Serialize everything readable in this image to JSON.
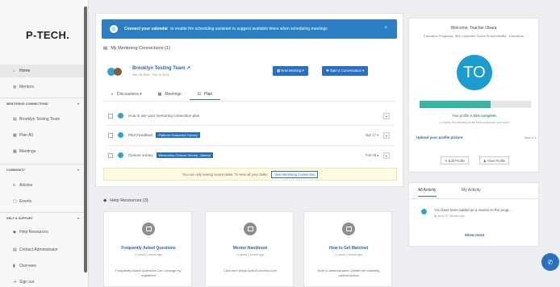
{
  "brand": {
    "logo": "P-TECH."
  },
  "sidebar": {
    "top_items": [
      {
        "label": "Home",
        "icon": "home-icon",
        "glyph": "⌂"
      },
      {
        "label": "Mentors",
        "icon": "person-icon",
        "glyph": "◍"
      }
    ],
    "sections": [
      {
        "title": "MENTORING CONNECTIONS",
        "items": [
          {
            "label": "Brooklyn Testing Team",
            "glyph": "▤"
          },
          {
            "label": "Plan All",
            "glyph": "▦"
          },
          {
            "label": "Meetings",
            "glyph": "▦"
          }
        ]
      },
      {
        "title": "COMMUNITY",
        "items": [
          {
            "label": "Articles",
            "glyph": "≡"
          },
          {
            "label": "Events",
            "glyph": "▢"
          }
        ]
      },
      {
        "title": "HELP & SUPPORT",
        "items": [
          {
            "label": "Help Resources",
            "glyph": "◆"
          },
          {
            "label": "Contact Administrator",
            "glyph": "▤"
          },
          {
            "label": "Overview",
            "glyph": "▮"
          },
          {
            "label": "Sign out",
            "glyph": "⇥"
          }
        ]
      }
    ]
  },
  "banner": {
    "bold": "Connect your calendar",
    "text": "to enable the scheduling assistant to suggest available times when scheduling meetings",
    "close": "×"
  },
  "mentoring": {
    "section_title": "My Mentoring Connections (1)",
    "team_name": "Brooklyn Testing Team ↗",
    "dates": "Feb 05 2020 - Feb 11 2021",
    "new_meeting": "▦ New Meeting ▾",
    "start_conversation": "✚ Start a Conversation ▾",
    "tabs": [
      {
        "label": "Discussions ▾",
        "glyph": "◐"
      },
      {
        "label": "Meetings",
        "glyph": "▦"
      },
      {
        "label": "Plan",
        "glyph": "☑"
      }
    ],
    "plan_rows": [
      {
        "text": "How to use your mentoring connection plan",
        "tag": "",
        "date": ""
      },
      {
        "text": "Pilot Feedback",
        "tag": "Platform Evaluation Survey",
        "date": "Mar 17 ▾"
      },
      {
        "text": "Closure survey",
        "tag": "Mentorship Closure Survey - Mentor",
        "date": "Feb 09 ▾"
      }
    ],
    "notice": "You can only seeing recent tasks. To view all your tasks,",
    "notice_button": "Visit Mentoring Connection"
  },
  "help": {
    "section_title": "Help Resources (3)",
    "cards": [
      {
        "title": "Frequently Asked Questions",
        "meta": "⊙ about 1 month ago",
        "body": "Frequently Asked Questions Can I change my registered"
      },
      {
        "title": "Mentor Handbook",
        "meta": "⊙ about 1 month ago",
        "body": "Click here (https://ptech.chronus.com"
      },
      {
        "title": "How to Get Matched",
        "meta": "⊙ about 1 month ago",
        "body": "Note to administrators: Delete the matching method below"
      }
    ]
  },
  "profile": {
    "welcome": "Welcome, Teacher Obara",
    "subtitle": "Education Programs, IBM Corporate Social Responsibility · Educators",
    "avatar_initials": "TO",
    "progress": 0.64,
    "complete_prefix": "Your profile is",
    "complete_value": "64% complete.",
    "hint": "Complete the following profile fields to improve your score",
    "upload": "Upload your profile picture",
    "back": "Back to 6",
    "edit": "✎ Edit Profile",
    "view": "♟ View Profile"
  },
  "activity": {
    "tabs": [
      "All Activity",
      "My Activity"
    ],
    "message": "You have been added as a mentor to the progr...",
    "time": "♟ about 21 minutes ago",
    "show_more": "Show more"
  },
  "chat": {
    "glyph": "✆"
  },
  "colors": {
    "accent": "#2a6fc2",
    "banner": "#2a7fc2",
    "avatar": "#1b9ccf",
    "progress": "#35b6a2"
  }
}
